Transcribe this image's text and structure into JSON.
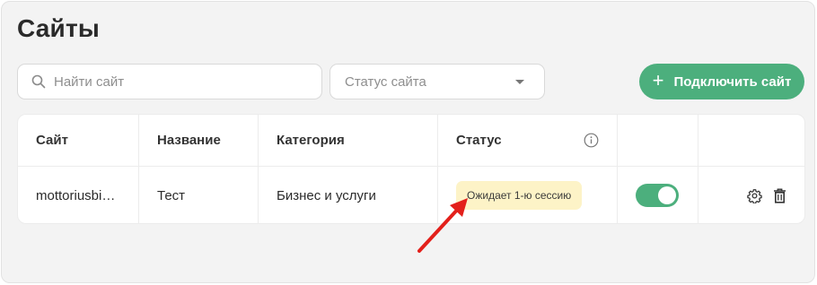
{
  "page": {
    "title": "Сайты"
  },
  "toolbar": {
    "search_placeholder": "Найти сайт",
    "search_value": "",
    "status_filter_value": "Статус сайта",
    "connect_button_label": "Подключить сайт",
    "connect_button_icon": "plus-icon"
  },
  "table": {
    "columns": [
      "Сайт",
      "Название",
      "Категория",
      "Статус",
      "",
      ""
    ],
    "rows": [
      {
        "site": "mottoriusbi…",
        "name": "Тест",
        "category": "Бизнес и услуги",
        "status": "Ожидает 1-ю сессию",
        "enabled": true
      }
    ]
  },
  "colors": {
    "accent": "#4caf7d",
    "status_badge_bg": "#fdf3c7",
    "annotation_arrow": "#e3201b",
    "panel_bg": "#f3f3f3"
  },
  "icons": {
    "search": "search-icon",
    "status_info": "info-icon",
    "dropdown": "chevron-down-icon",
    "settings": "gear-icon",
    "delete": "trash-icon",
    "annotation": "red-arrow-icon"
  }
}
